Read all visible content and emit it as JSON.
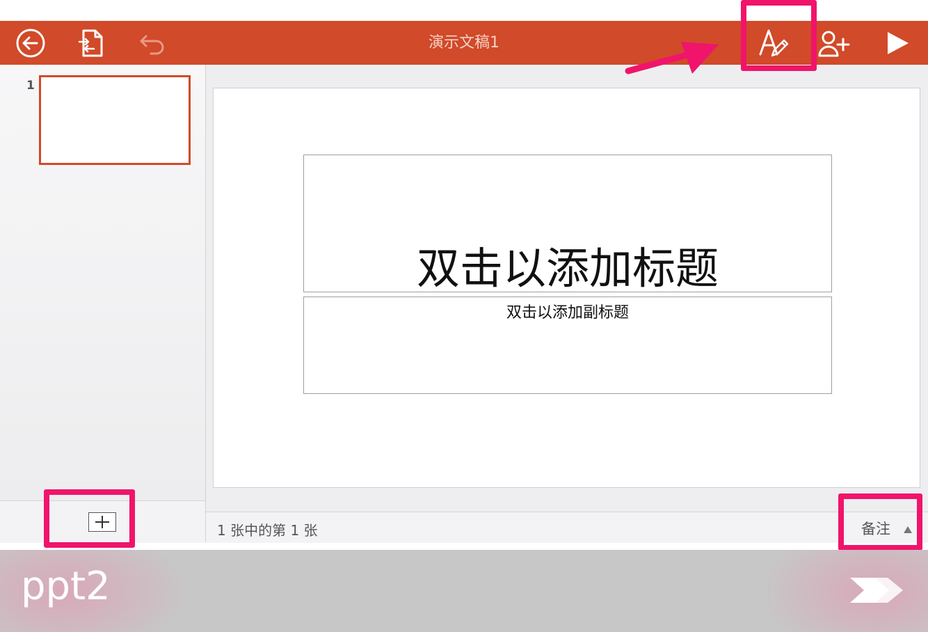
{
  "toolbar": {
    "title": "演示文稿1",
    "back_icon": "back-arrow-circle-icon",
    "share_icon": "document-sync-icon",
    "undo_icon": "undo-icon",
    "format_icon": "text-format-pen-icon",
    "add_person_icon": "add-person-icon",
    "play_icon": "play-icon",
    "background_color": "#d14a29"
  },
  "thumbnails": {
    "items": [
      {
        "number": "1",
        "selected": true
      }
    ],
    "selected_border_color": "#d14a29"
  },
  "slide": {
    "title_placeholder": "双击以添加标题",
    "subtitle_placeholder": "双击以添加副标题"
  },
  "statusbar": {
    "slide_position": "1 张中的第 1 张",
    "notes_label": "备注"
  },
  "annotation": {
    "highlight_color": "#f0146b"
  },
  "watermark": {
    "label": "ppt2"
  }
}
